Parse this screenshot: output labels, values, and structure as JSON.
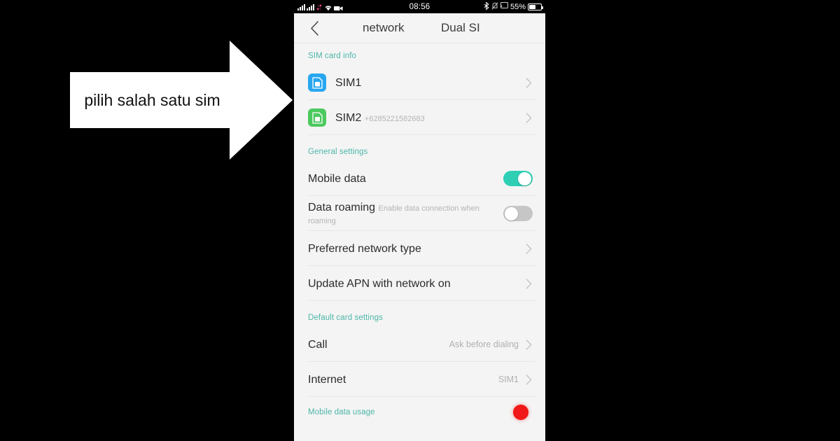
{
  "annotation": {
    "text": "pilih salah satu sim",
    "shape": "right-arrow",
    "fill_color": "#ffffff",
    "backdrop_color": "#000000"
  },
  "status_bar": {
    "time": "08:56",
    "battery_percent": "55%",
    "left_icons": [
      "signal-bars-sim1-icon",
      "signal-bars-sim2-icon",
      "data-transfer-icon",
      "wifi-icon",
      "screen-recorder-icon"
    ],
    "right_icons": [
      "bluetooth-icon",
      "vibrate-icon",
      "cast-icon",
      "battery-icon"
    ]
  },
  "title_bar": {
    "back_icon": "chevron-left-icon",
    "outgoing_title": "network",
    "incoming_title": "Dual SI"
  },
  "sections": [
    {
      "header": "SIM card info",
      "rows": [
        {
          "icon": "sim-card-1-icon",
          "icon_color": "#28a7f0",
          "title": "SIM1",
          "subtitle": "",
          "value": "",
          "accessory": "chevron-right-icon"
        },
        {
          "icon": "sim-card-2-icon",
          "icon_color": "#4cc95e",
          "title": "SIM2",
          "subtitle": "+6285221582683",
          "value": "",
          "accessory": "chevron-right-icon"
        }
      ]
    },
    {
      "header": "General settings",
      "rows": [
        {
          "title": "Mobile data",
          "subtitle": "",
          "value": "",
          "accessory": "toggle-on"
        },
        {
          "title": "Data roaming",
          "subtitle": "Enable data connection when roaming",
          "value": "",
          "accessory": "toggle-off"
        },
        {
          "title": "Preferred network type",
          "subtitle": "",
          "value": "",
          "accessory": "chevron-right-icon"
        },
        {
          "title": "Update APN with network on",
          "subtitle": "",
          "value": "",
          "accessory": "chevron-right-icon"
        }
      ]
    },
    {
      "header": "Default card settings",
      "rows": [
        {
          "title": "Call",
          "subtitle": "",
          "value": "Ask before dialing",
          "accessory": "chevron-right-icon"
        },
        {
          "title": "Internet",
          "subtitle": "",
          "value": "SIM1",
          "accessory": "chevron-right-icon"
        }
      ]
    },
    {
      "header": "Mobile data usage",
      "rows": []
    }
  ],
  "recording_indicator": {
    "name": "recording-dot",
    "color": "#f01818"
  },
  "colors": {
    "accent_teal": "#2ecfb5",
    "section_header_teal": "#4db6a8",
    "screen_background": "#f4f4f4",
    "sim1_blue": "#28a7f0",
    "sim2_green": "#4cc95e"
  }
}
